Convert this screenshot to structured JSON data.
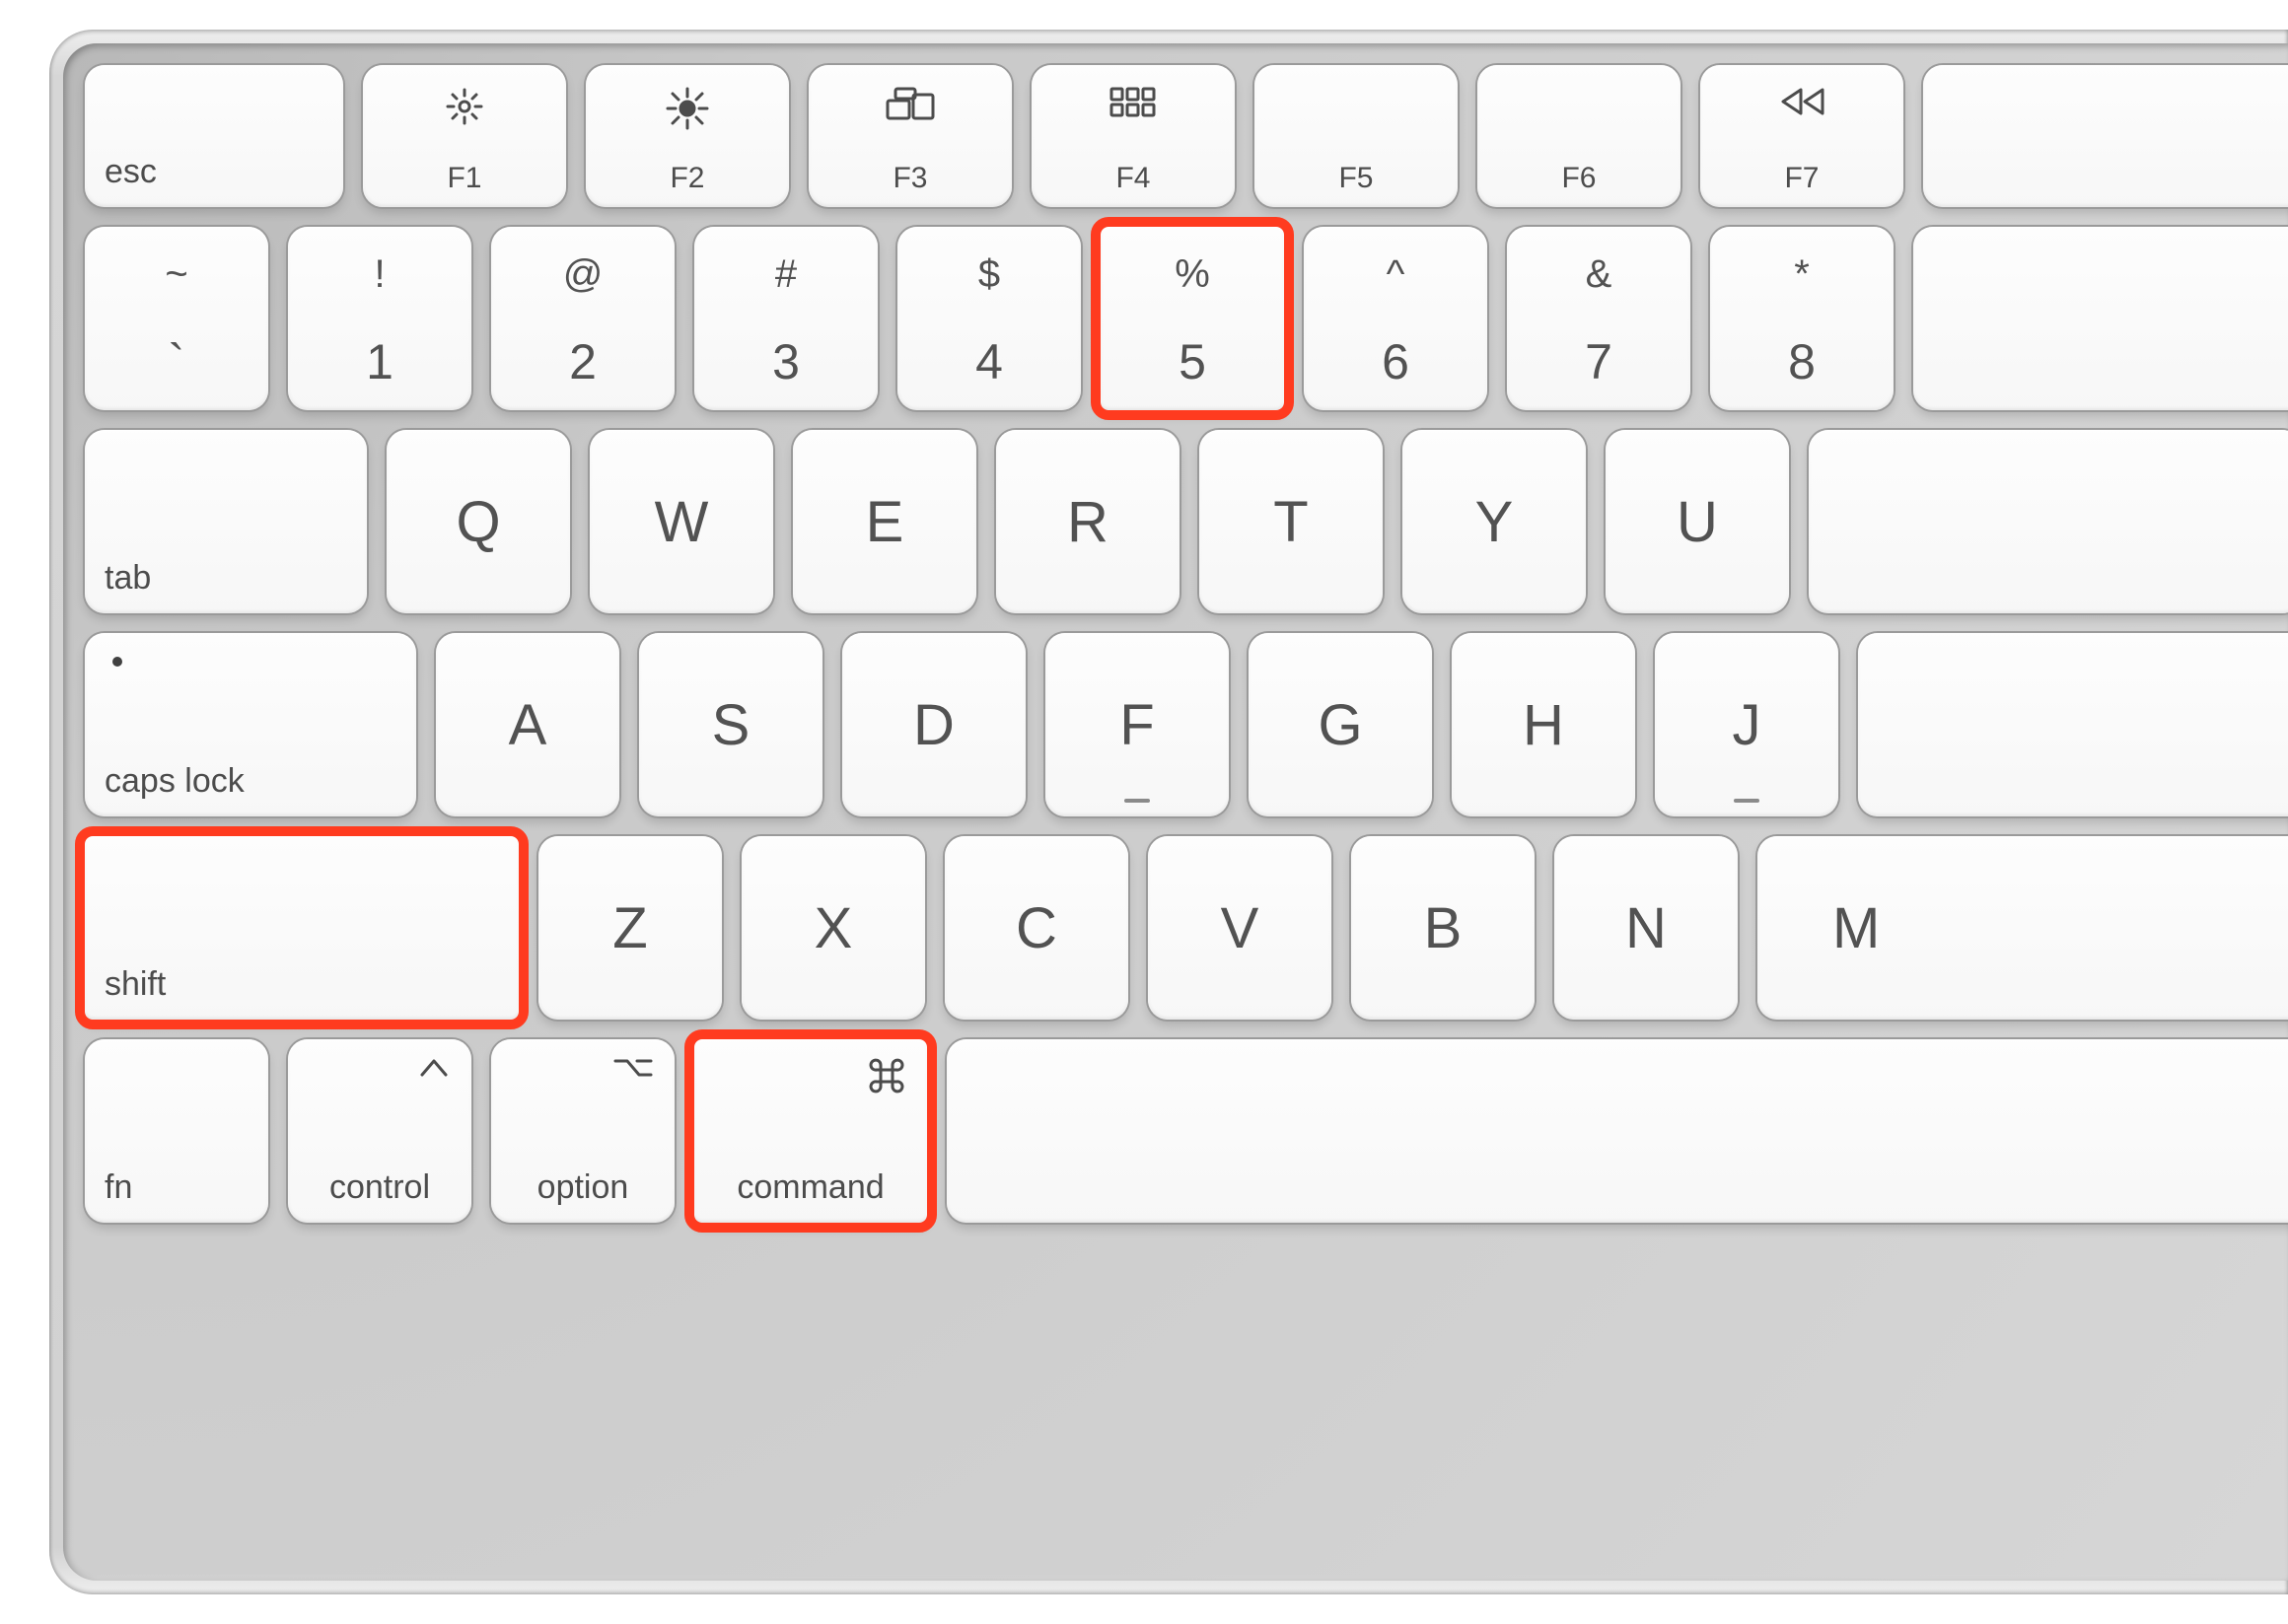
{
  "labels": {
    "esc": "esc",
    "tab": "tab",
    "caps": "caps lock",
    "shift": "shift",
    "fn": "fn",
    "control": "control",
    "option": "option",
    "command": "command",
    "f1": "F1",
    "f2": "F2",
    "f3": "F3",
    "f4": "F4",
    "f5": "F5",
    "f6": "F6",
    "f7": "F7"
  },
  "num": {
    "k1u": "!",
    "k1l": "1",
    "k2u": "@",
    "k2l": "2",
    "k3u": "#",
    "k3l": "3",
    "k4u": "$",
    "k4l": "4",
    "k5u": "%",
    "k5l": "5",
    "k6u": "^",
    "k6l": "6",
    "k7u": "&",
    "k7l": "7",
    "k8u": "*",
    "k8l": "8",
    "ktu": "~",
    "ktl": "`"
  },
  "letters": {
    "q": "Q",
    "w": "W",
    "e": "E",
    "r": "R",
    "t": "T",
    "y": "Y",
    "u": "U",
    "a": "A",
    "s": "S",
    "d": "D",
    "f": "F",
    "g": "G",
    "h": "H",
    "j": "J",
    "z": "Z",
    "x": "X",
    "c": "C",
    "v": "V",
    "b": "B",
    "n": "N",
    "m": "M"
  },
  "highlight": {
    "keys": [
      "key-5",
      "key-shift",
      "key-command"
    ],
    "color": "#ff3b1f",
    "meaning": "keyboard shortcut combination (Shift + Command + 5)"
  },
  "colors": {
    "keycap": "#fdfdfd",
    "frame": "#d2d2d2",
    "label": "#4c4c4c",
    "highlight": "#ff3b1f"
  }
}
